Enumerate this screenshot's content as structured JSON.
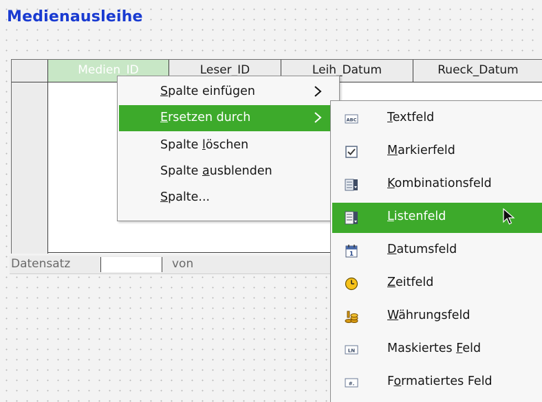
{
  "form": {
    "title": "Medienausleihe"
  },
  "grid": {
    "columns": [
      "Medien_ID",
      "Leser_ID",
      "Leih_Datum",
      "Rueck_Datum"
    ],
    "selected_column": "Medien_ID"
  },
  "navigation": {
    "record_label": "Datensatz",
    "record_value": "",
    "of_label": "von"
  },
  "context_menu": {
    "items": [
      {
        "pre": "",
        "accel": "S",
        "post": "palte einfügen",
        "has_submenu": true
      },
      {
        "pre": "",
        "accel": "E",
        "post": "rsetzen durch",
        "has_submenu": true,
        "highlighted": true
      },
      {
        "pre": "Spalte ",
        "accel": "l",
        "post": "öschen",
        "has_submenu": false
      },
      {
        "pre": "Spalte ",
        "accel": "a",
        "post": "usblenden",
        "has_submenu": false
      },
      {
        "pre": "",
        "accel": "S",
        "post": "palte...",
        "has_submenu": false
      }
    ]
  },
  "submenu": {
    "items": [
      {
        "icon": "textfield-icon",
        "pre": "",
        "accel": "T",
        "post": "extfeld"
      },
      {
        "icon": "checkbox-icon",
        "pre": "",
        "accel": "M",
        "post": "arkierfeld"
      },
      {
        "icon": "combobox-icon",
        "pre": "",
        "accel": "K",
        "post": "ombinationsfeld"
      },
      {
        "icon": "listbox-icon",
        "pre": "",
        "accel": "L",
        "post": "istenfeld",
        "highlighted": true
      },
      {
        "icon": "calendar-icon",
        "pre": "",
        "accel": "D",
        "post": "atumsfeld"
      },
      {
        "icon": "clock-icon",
        "pre": "",
        "accel": "Z",
        "post": "eitfeld"
      },
      {
        "icon": "currency-icon",
        "pre": "",
        "accel": "W",
        "post": "ährungsfeld"
      },
      {
        "icon": "masked-field-icon",
        "pre": "Maskiertes ",
        "accel": "F",
        "post": "eld"
      },
      {
        "icon": "formatted-field-icon",
        "pre": "F",
        "accel": "o",
        "post": "rmatiertes Feld"
      }
    ]
  },
  "colors": {
    "title": "#1a3bd1",
    "highlight": "#3daa2b",
    "selected_header": "#c8e7c6"
  }
}
